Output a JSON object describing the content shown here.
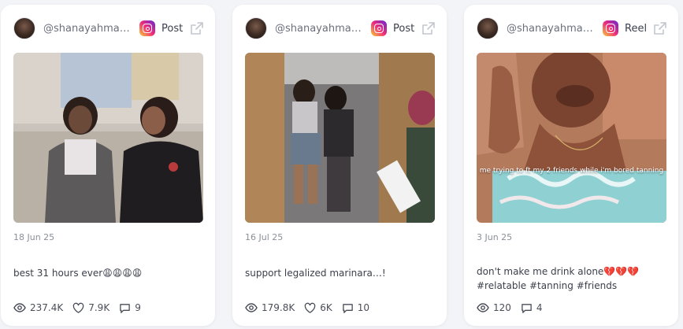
{
  "posts": [
    {
      "username": "@shanayahmari...",
      "type": "Post",
      "date": "18 Jun 25",
      "caption": "best 31 hours ever😩😩😩😩",
      "views": "237.4K",
      "likes": "7.9K",
      "comments": "9"
    },
    {
      "username": "@shanayahmari...",
      "type": "Post",
      "date": "16 Jul 25",
      "caption": "support legalized marinara…!",
      "views": "179.8K",
      "likes": "6K",
      "comments": "10"
    },
    {
      "username": "@shanayahmari...",
      "type": "Reel",
      "date": "3 Jun 25",
      "caption": "don't make me drink alone💔💔💔 #relatable #tanning #friends",
      "overlay_text": "me trying to ft my 2 friends while i'm bored tanning",
      "views": "120",
      "comments": "4"
    }
  ],
  "icons": {
    "platform": "instagram-icon",
    "external": "external-link-icon",
    "views": "eye-icon",
    "likes": "heart-icon",
    "comments": "comment-icon"
  },
  "colors": {
    "background": "#f3f4f8",
    "card": "#ffffff",
    "muted_text": "#8a8f9a",
    "body_text": "#3b3f4a"
  }
}
